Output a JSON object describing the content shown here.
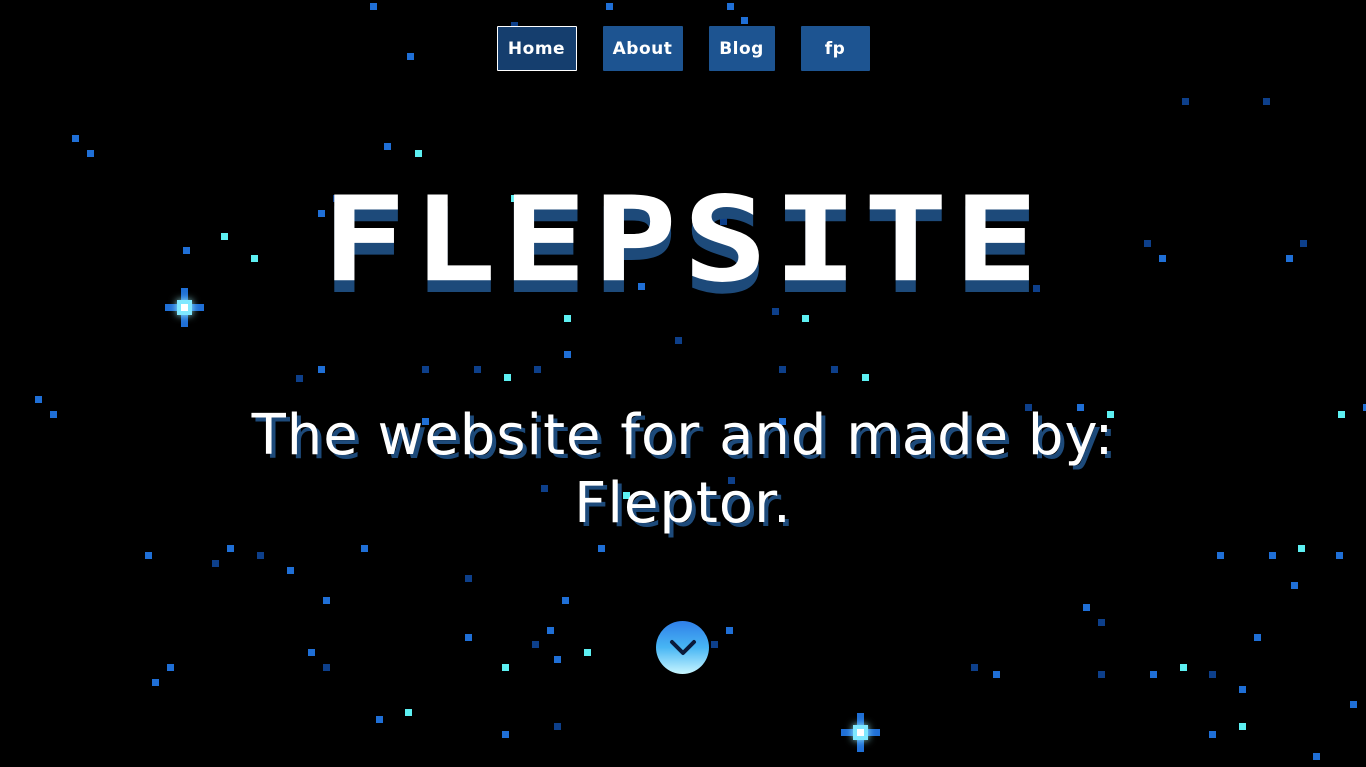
{
  "nav": {
    "items": [
      {
        "label": "Home",
        "active": true
      },
      {
        "label": "About",
        "active": false
      },
      {
        "label": "Blog",
        "active": false
      },
      {
        "label": "fp",
        "active": false
      }
    ]
  },
  "hero": {
    "title": "FLEPSITE",
    "subtitle_line1": "The website for and made by:",
    "subtitle_line2": "Fleptor."
  },
  "scroll_button": {
    "icon": "chevron-down-icon"
  },
  "colors": {
    "background": "#000000",
    "nav_button": "#1d5491",
    "nav_button_active": "#153e6e",
    "title_shadow": "#1d4a7a",
    "star_dark": "#0d3f8a",
    "star_blue": "#1f6fd6",
    "star_cyan": "#5df0f2"
  }
}
